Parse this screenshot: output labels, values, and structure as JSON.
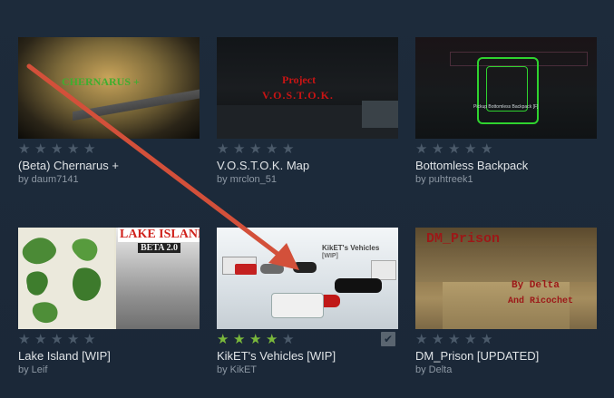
{
  "items": [
    {
      "title": "(Beta) Chernarus +",
      "author": "by daum7141",
      "rating": 0,
      "thumb_text": "CHERNARUS +"
    },
    {
      "title": "V.O.S.T.O.K. Map",
      "author": "by mrclon_51",
      "rating": 0,
      "thumb_text_1": "Project",
      "thumb_text_2": "V.O.S.T.O.K."
    },
    {
      "title": "Bottomless Backpack",
      "author": "by puhtreek1",
      "rating": 0,
      "thumb_text": "Pickup Bottomless Backpack [F]"
    },
    {
      "title": "Lake Island [WIP]",
      "author": "by Leif",
      "rating": 0,
      "thumb_text_1": "LAKE ISLAND",
      "thumb_text_2": "BETA 2.0"
    },
    {
      "title": "KikET's Vehicles [WIP]",
      "author": "by KikET",
      "rating": 4,
      "thumb_text_1": "KikET's Vehicles",
      "thumb_text_2": "[WIP]",
      "subscribed": true
    },
    {
      "title": "DM_Prison [UPDATED]",
      "author": "by Delta",
      "rating": 0,
      "thumb_text_1": "DM_Prison",
      "thumb_text_2": "By Delta",
      "thumb_text_3": "And Ricochet"
    }
  ],
  "icons": {
    "star": "star-icon",
    "check": "checkmark-icon"
  },
  "colors": {
    "star_on": "#7ab83b",
    "star_off": "#4b5a6a",
    "arrow": "#d3503a"
  }
}
